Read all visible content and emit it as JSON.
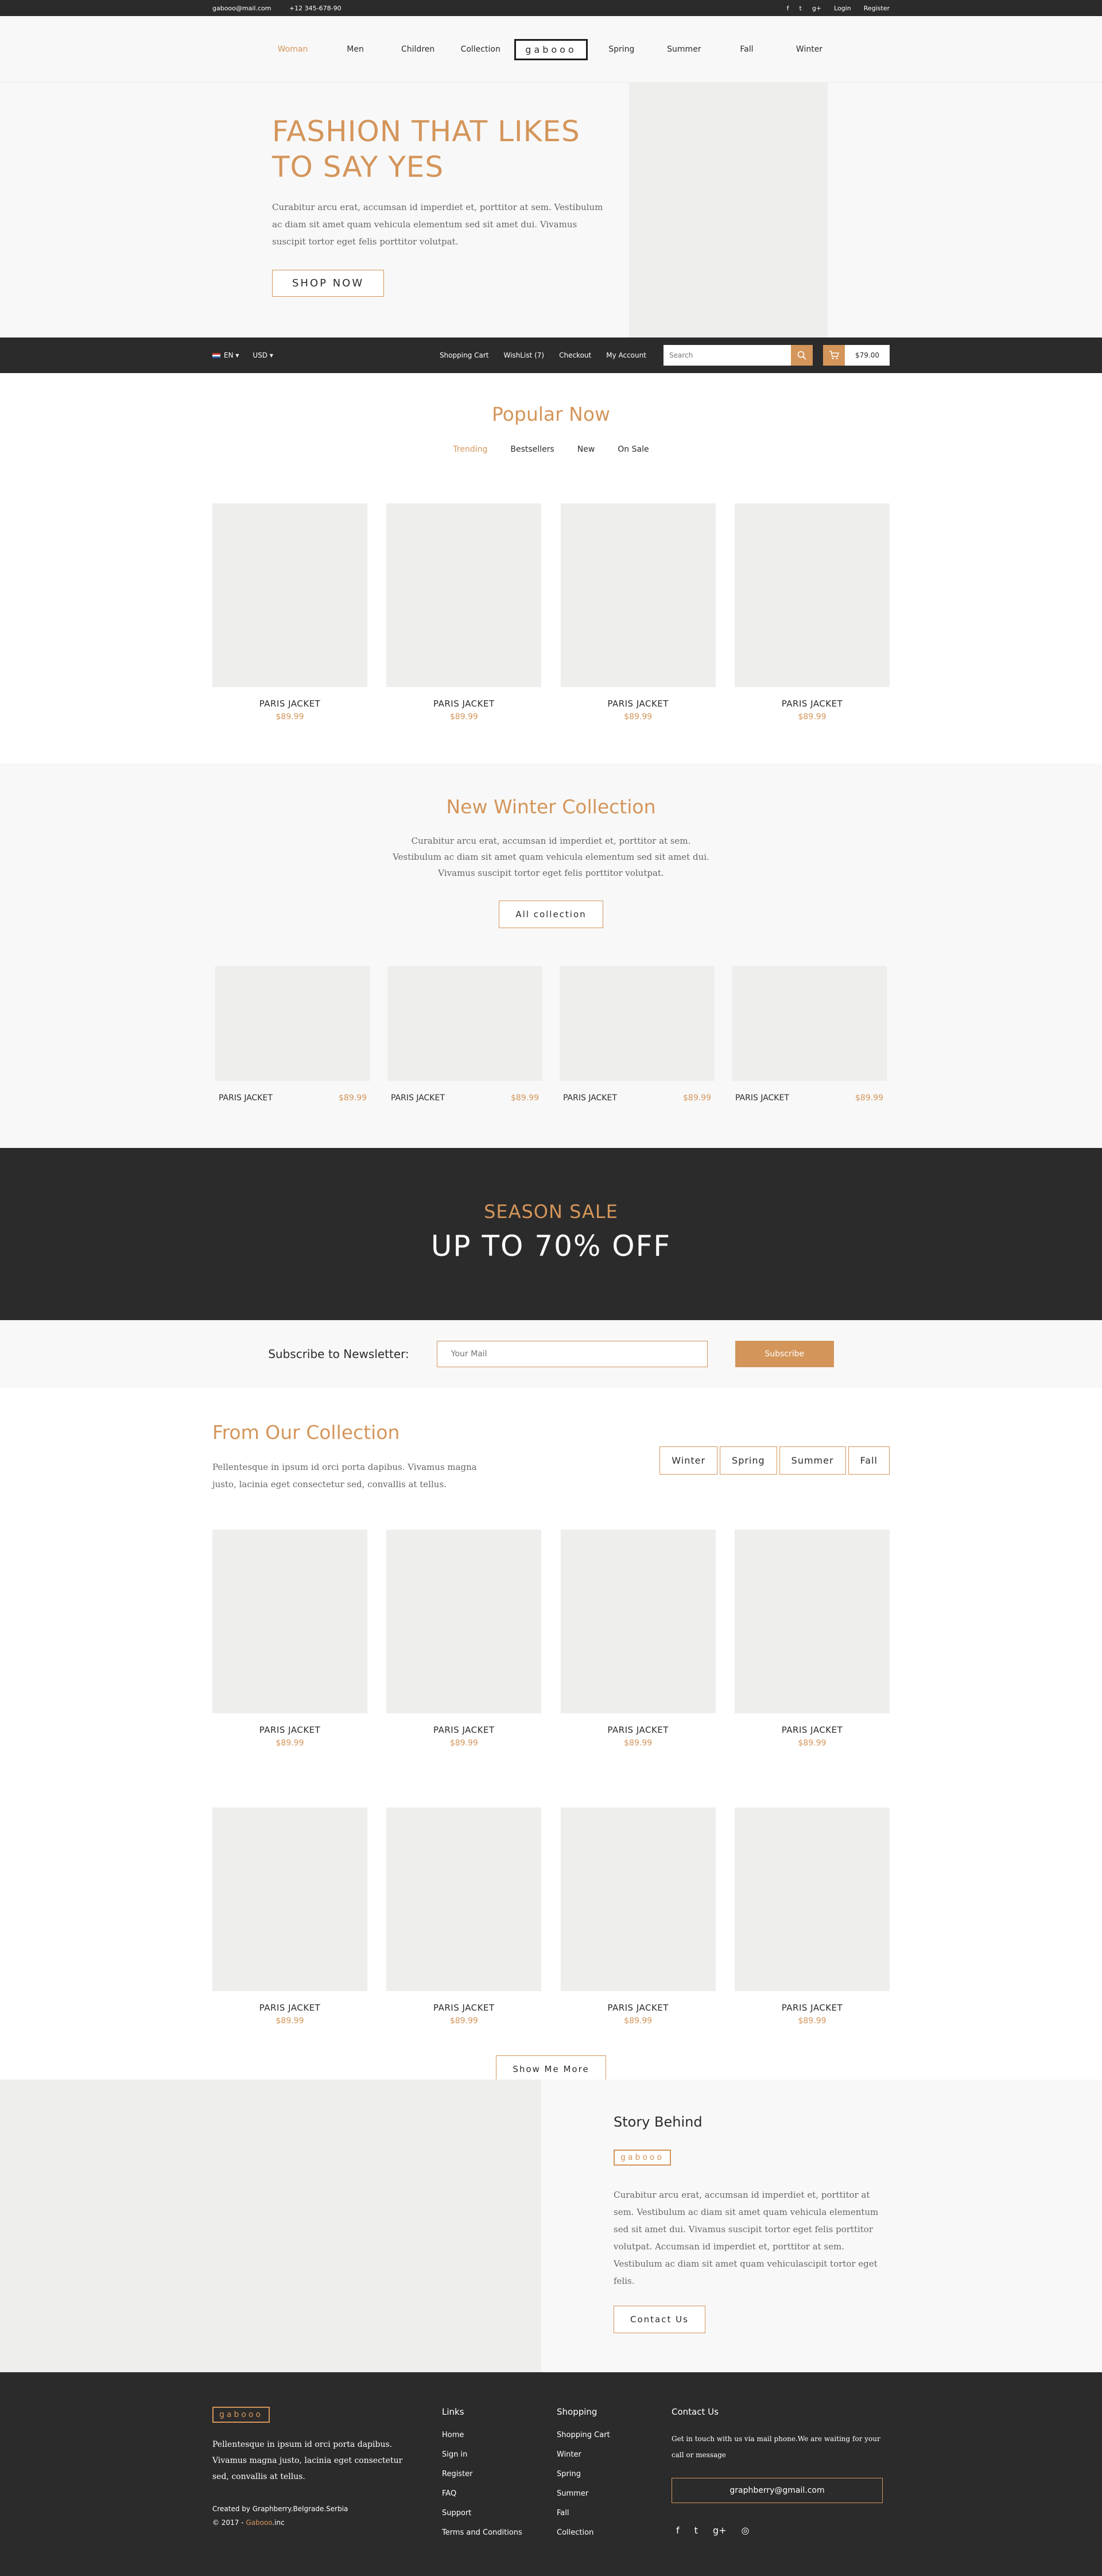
{
  "topbar": {
    "email": "gabooo@mail.com",
    "phone": "+12 345-678-90",
    "social": [
      "f",
      "t",
      "g+"
    ],
    "login": "Login",
    "register": "Register"
  },
  "nav": {
    "left": [
      "Woman",
      "Men",
      "Children",
      "Collection"
    ],
    "logo": "gabooo",
    "right": [
      "Spring",
      "Summer",
      "Fall",
      "Winter"
    ]
  },
  "hero": {
    "title_line1": "FASHION THAT LIKES",
    "title_line2": "TO SAY YES",
    "text": "Curabitur arcu erat, accumsan id imperdiet et, porttitor at sem. Vestibulum ac diam sit amet quam vehicula elementum sed sit amet dui. Vivamus suscipit tortor eget felis porttitor volutpat.",
    "button": "SHOP NOW"
  },
  "shopbar": {
    "language": "EN",
    "currency": "USD",
    "links": [
      "Shopping Cart",
      "WishList (7)",
      "Checkout",
      "My Account"
    ],
    "search_placeholder": "Search",
    "cart_total": "$79.00"
  },
  "popular": {
    "title": "Popular Now",
    "tabs": [
      "Trending",
      "Bestsellers",
      "New",
      "On Sale"
    ],
    "products": [
      {
        "name": "PARIS JACKET",
        "price": "$89.99"
      },
      {
        "name": "PARIS JACKET",
        "price": "$89.99"
      },
      {
        "name": "PARIS JACKET",
        "price": "$89.99"
      },
      {
        "name": "PARIS JACKET",
        "price": "$89.99"
      }
    ]
  },
  "winter": {
    "title": "New Winter Collection",
    "text": "Curabitur arcu erat, accumsan id imperdiet et, porttitor at sem. Vestibulum ac diam sit amet quam vehicula elementum sed sit amet dui. Vivamus suscipit tortor eget felis porttitor volutpat.",
    "button": "All collection",
    "products": [
      {
        "name": "PARIS JACKET",
        "price": "$89.99"
      },
      {
        "name": "PARIS JACKET",
        "price": "$89.99"
      },
      {
        "name": "PARIS JACKET",
        "price": "$89.99"
      },
      {
        "name": "PARIS JACKET",
        "price": "$89.99"
      }
    ]
  },
  "sale": {
    "small": "SEASON SALE",
    "big": "UP TO 70% OFF"
  },
  "newsletter": {
    "label": "Subscribe to Newsletter:",
    "placeholder": "Your Mail",
    "button": "Subscribe"
  },
  "collection": {
    "title": "From Our Collection",
    "text": "Pellentesque in ipsum id orci porta dapibus. Vivamus magna justo, lacinia eget consectetur sed, convallis at tellus.",
    "seasons": [
      "Winter",
      "Spring",
      "Summer",
      "Fall"
    ],
    "products": [
      {
        "name": "PARIS JACKET",
        "price": "$89.99"
      },
      {
        "name": "PARIS JACKET",
        "price": "$89.99"
      },
      {
        "name": "PARIS JACKET",
        "price": "$89.99"
      },
      {
        "name": "PARIS JACKET",
        "price": "$89.99"
      },
      {
        "name": "PARIS JACKET",
        "price": "$89.99"
      },
      {
        "name": "PARIS JACKET",
        "price": "$89.99"
      },
      {
        "name": "PARIS JACKET",
        "price": "$89.99"
      },
      {
        "name": "PARIS JACKET",
        "price": "$89.99"
      }
    ],
    "show_more": "Show Me More"
  },
  "story": {
    "title": "Story Behind",
    "logo": "gabooo",
    "text": "Curabitur arcu erat, accumsan id imperdiet et, porttitor at sem. Vestibulum ac diam sit amet quam vehicula elementum sed sit amet dui. Vivamus suscipit tortor eget felis porttitor volutpat. Accumsan id imperdiet et, porttitor at sem. Vestibulum ac diam sit amet quam vehiculascipit tortor eget felis.",
    "button": "Contact Us"
  },
  "footer": {
    "logo": "gabooo",
    "about": "Pellentesque in ipsum id orci porta dapibus. Vivamus magna justo, lacinia eget consectetur sed, convallis at tellus.",
    "credit": "Created by Graphberry.Belgrade.Serbia",
    "copyright_prefix": "© 2017 - ",
    "copyright_brand": "Gabooo",
    "copyright_suffix": ".inc",
    "links_title": "Links",
    "links": [
      "Home",
      "Sign in",
      "Register",
      "FAQ",
      "Support",
      "Terms and Conditions"
    ],
    "shopping_title": "Shopping",
    "shopping": [
      "Shopping Cart",
      "Winter",
      "Spring",
      "Summer",
      "Fall",
      "Collection"
    ],
    "contact_title": "Contact Us",
    "contact_text": "Get in touch with us via mail phone.We are waiting for your call or message",
    "contact_email": "graphberry@gmail.com",
    "social": [
      "f",
      "t",
      "g+",
      "◎"
    ]
  },
  "colors": {
    "accent": "#d4955a",
    "dark": "#2b2b2b",
    "light_bg": "#f8f8f8",
    "placeholder": "#eeeeec"
  }
}
